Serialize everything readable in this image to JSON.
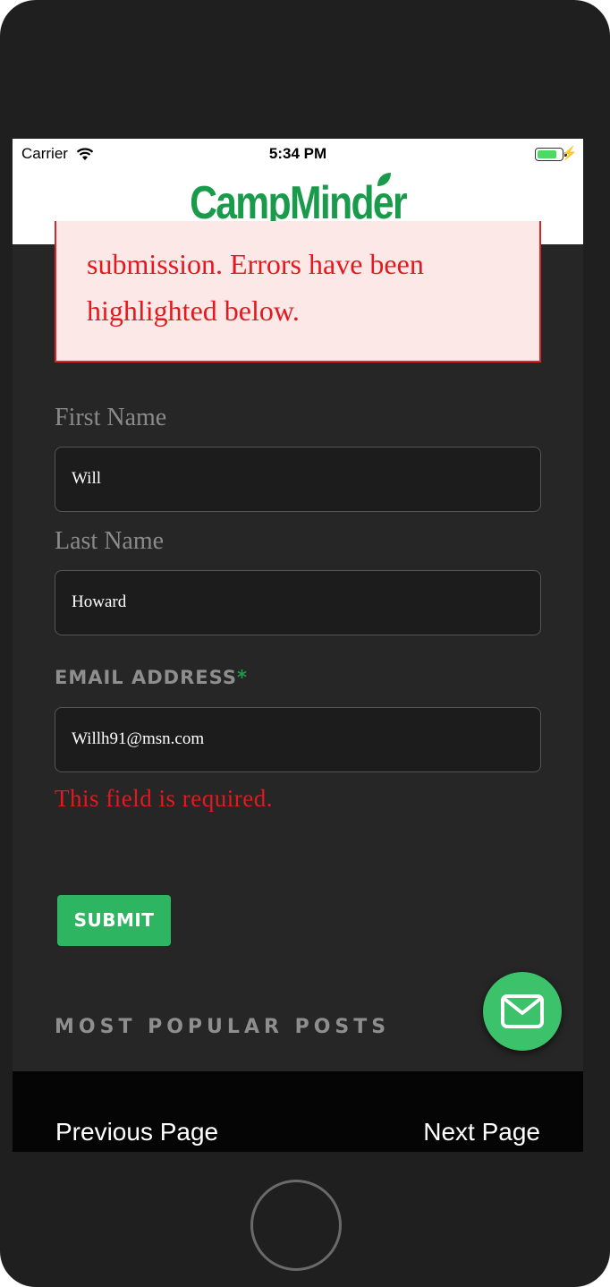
{
  "status": {
    "carrier": "Carrier",
    "time": "5:34 PM"
  },
  "header": {
    "logo": "CampMinder"
  },
  "error_message": {
    "line1": "submission. Errors have been",
    "line2": "highlighted below."
  },
  "form": {
    "first_name": {
      "label": "First Name",
      "value": "Will"
    },
    "last_name": {
      "label": "Last Name",
      "value": "Howard"
    },
    "email": {
      "label": "EMAIL ADDRESS",
      "required_mark": "*",
      "value": "Willh91@msn.com",
      "error": "This field is required."
    },
    "submit_label": "SUBMIT"
  },
  "section": {
    "popular_posts": "MOST POPULAR POSTS"
  },
  "pager": {
    "previous": "Previous Page",
    "next": "Next Page"
  },
  "colors": {
    "brand_green": "#1a9b4b",
    "error_red": "#e3191f",
    "button_green": "#2eb561"
  },
  "icons": {
    "fab": "mail-icon",
    "status_wifi": "wifi-icon",
    "status_battery": "battery-icon"
  }
}
